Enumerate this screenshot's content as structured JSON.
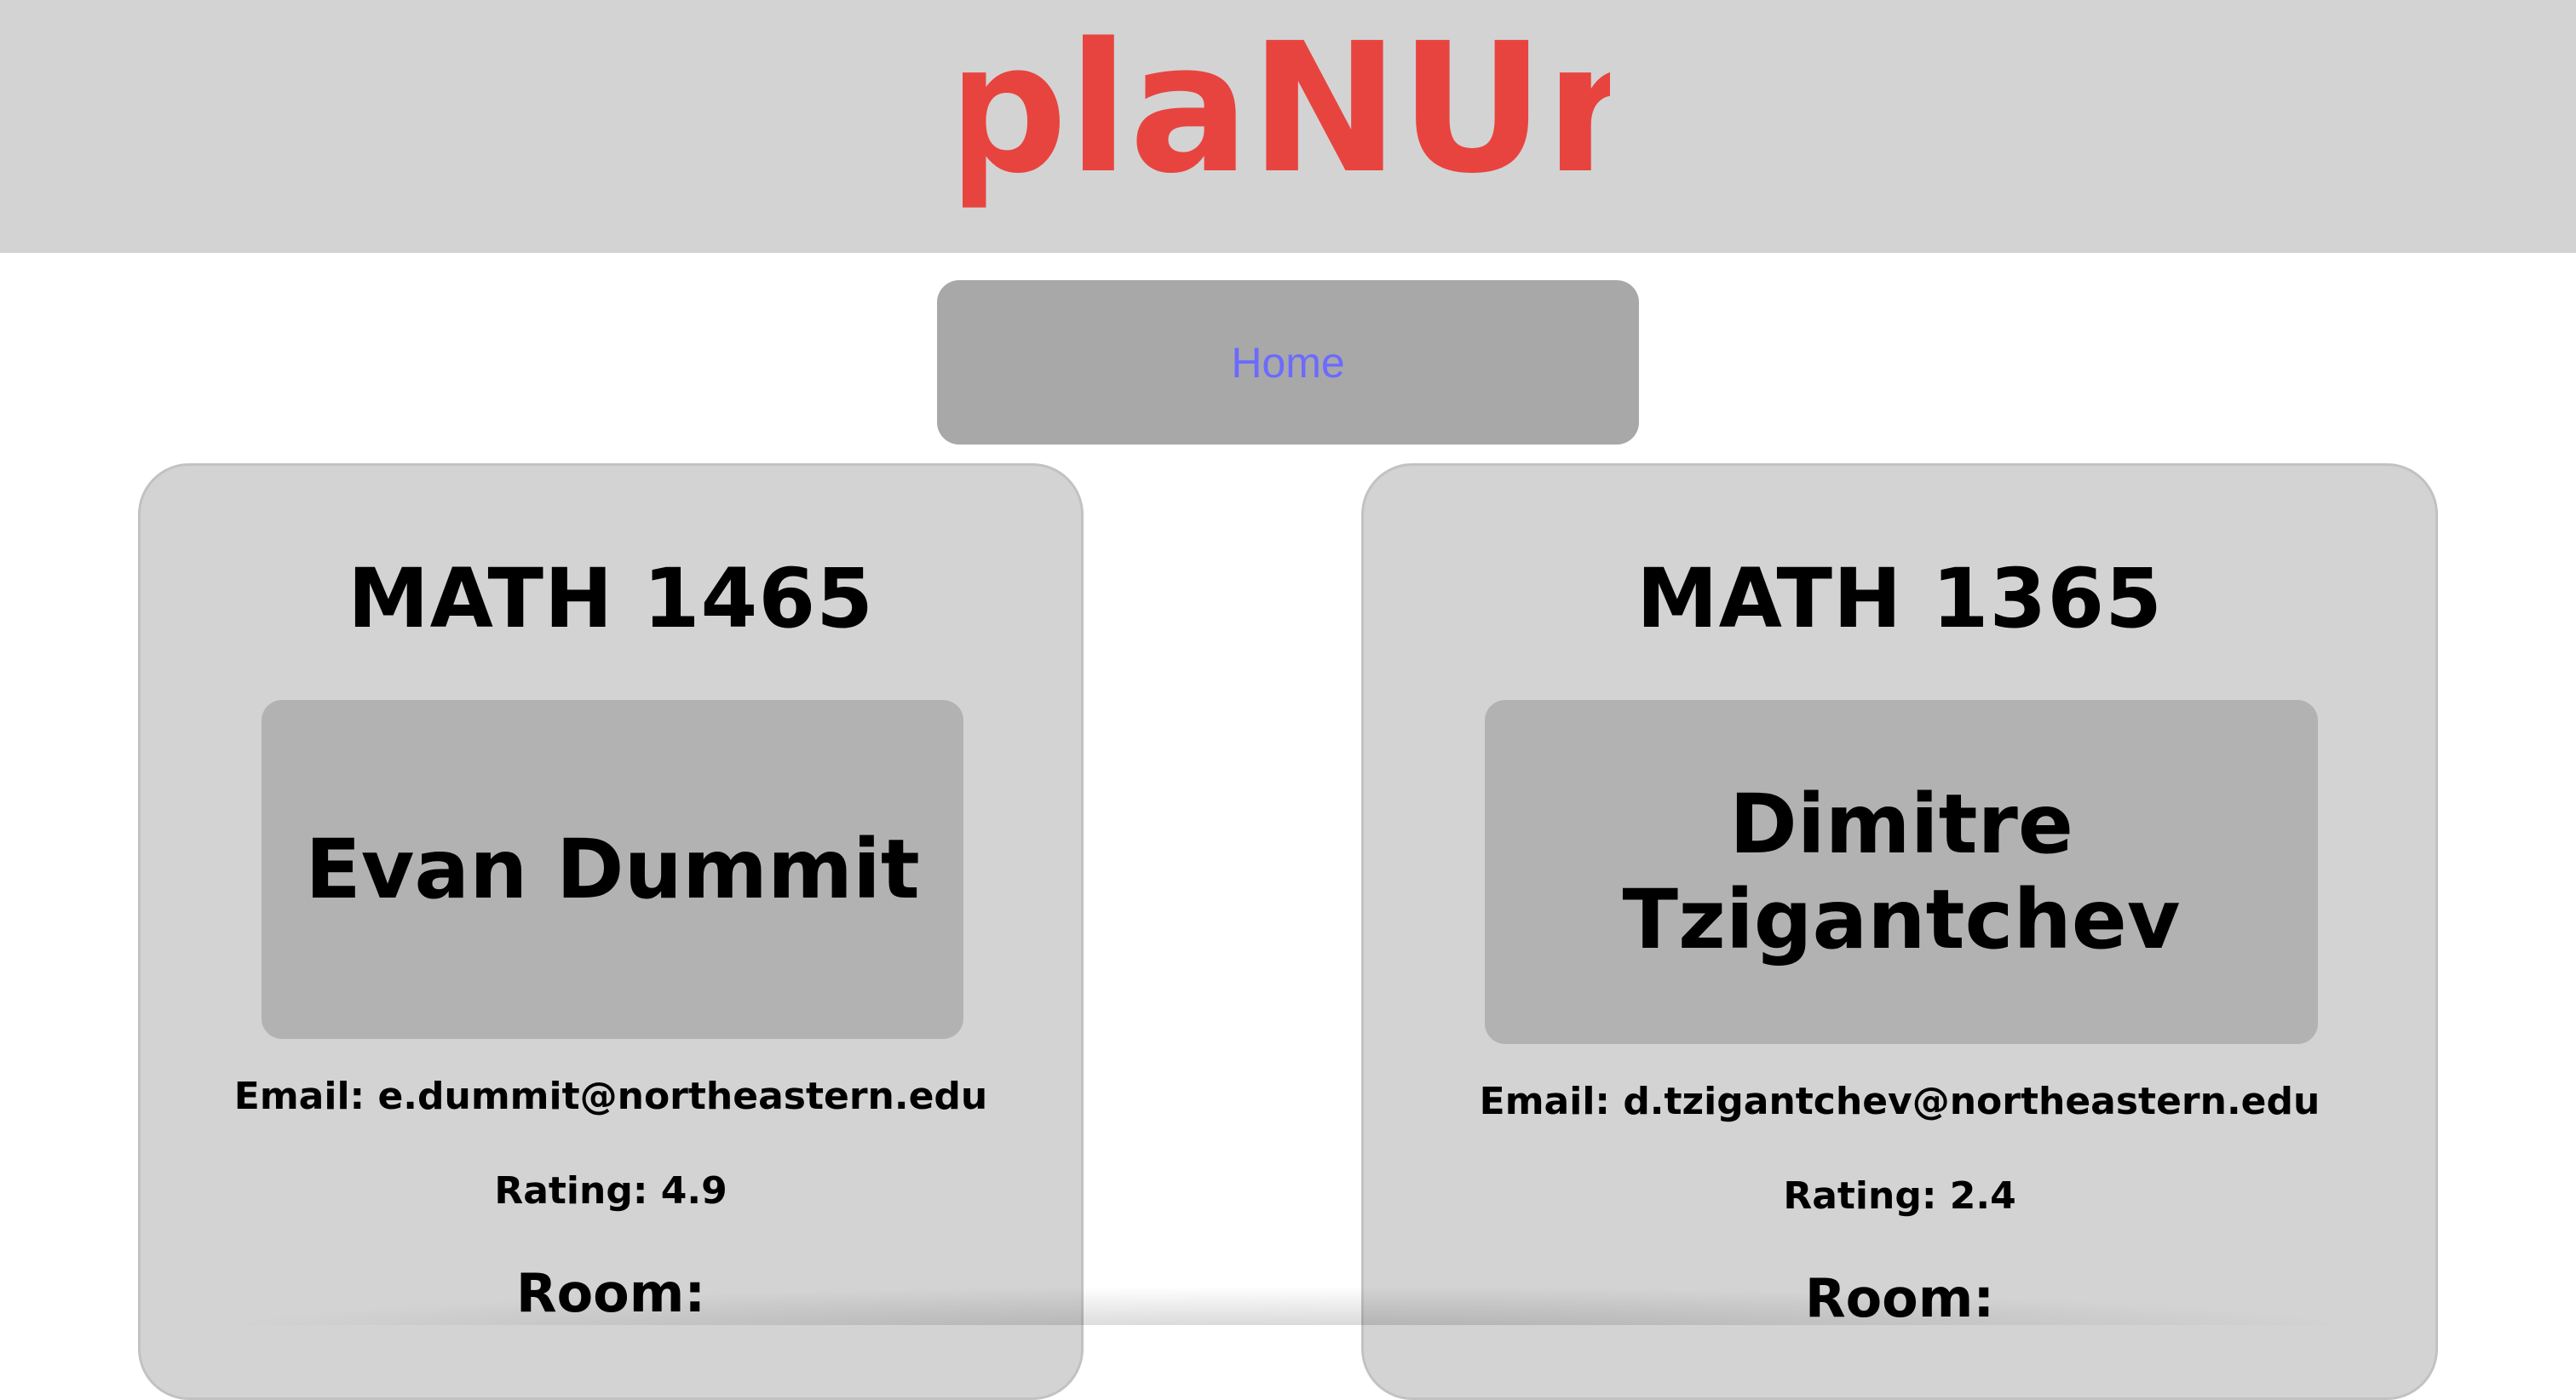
{
  "header": {
    "logo_text": "plaNUr",
    "logo_color": "#e8443f"
  },
  "nav": {
    "home_label": "Home",
    "home_color": "#6b6bff"
  },
  "cards": [
    {
      "course": "MATH 1465",
      "professor": "Evan Dummit",
      "email": "Email: e.dummit@northeastern.edu",
      "rating": "Rating: 4.9",
      "room": "Room:"
    },
    {
      "course": "MATH 1365",
      "professor": "Dimitre Tzigantchev",
      "email": "Email: d.tzigantchev@northeastern.edu",
      "rating": "Rating: 2.4",
      "room": "Room:"
    }
  ]
}
